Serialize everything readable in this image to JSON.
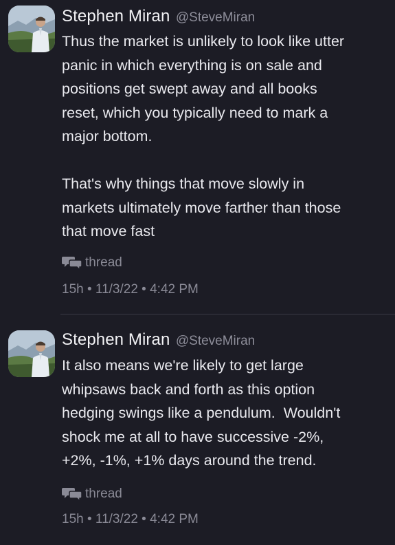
{
  "tweets": [
    {
      "author_name": "Stephen Miran",
      "author_handle": "@SteveMiran",
      "text": "Thus the market is unlikely to look like utter\npanic in which everything is on sale and\npositions get swept away and all books\nreset, which you typically need to mark a\nmajor bottom.\n\nThat's why things that move slowly in\nmarkets ultimately move farther than those\nthat move fast",
      "thread_label": "thread",
      "timestamp": "15h • 11/3/22 • 4:42 PM"
    },
    {
      "author_name": "Stephen Miran",
      "author_handle": "@SteveMiran",
      "text": "It also means we're likely to get large\nwhipsaws back and forth as this option\nhedging swings like a pendulum.  Wouldn't\nshock me at all to have successive -2%,\n+2%, -1%, +1% days around the trend.",
      "thread_label": "thread",
      "timestamp": "15h • 11/3/22 • 4:42 PM"
    }
  ],
  "icons": {
    "thread": "speech-bubbles-icon",
    "avatar": "profile-photo"
  },
  "colors": {
    "background": "#1c1c25",
    "text": "#e9e9ee",
    "secondary_text": "#8a8a96",
    "divider": "#3a3a46"
  }
}
